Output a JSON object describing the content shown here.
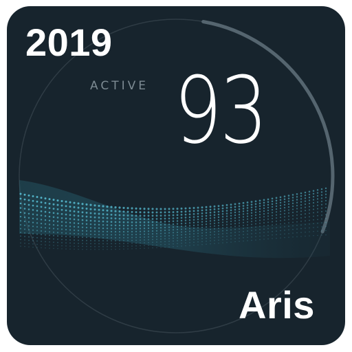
{
  "watchface": {
    "label": "ACTIVE",
    "value": "93",
    "progress_percent": 28
  },
  "overlay": {
    "year": "2019",
    "name": "Aris"
  },
  "colors": {
    "background": "#17242d",
    "ring": "#4b5a64",
    "progress_arc": "#55656f",
    "wave": "#5cc8df",
    "text": "#ffffff",
    "label": "#7d8b93"
  }
}
